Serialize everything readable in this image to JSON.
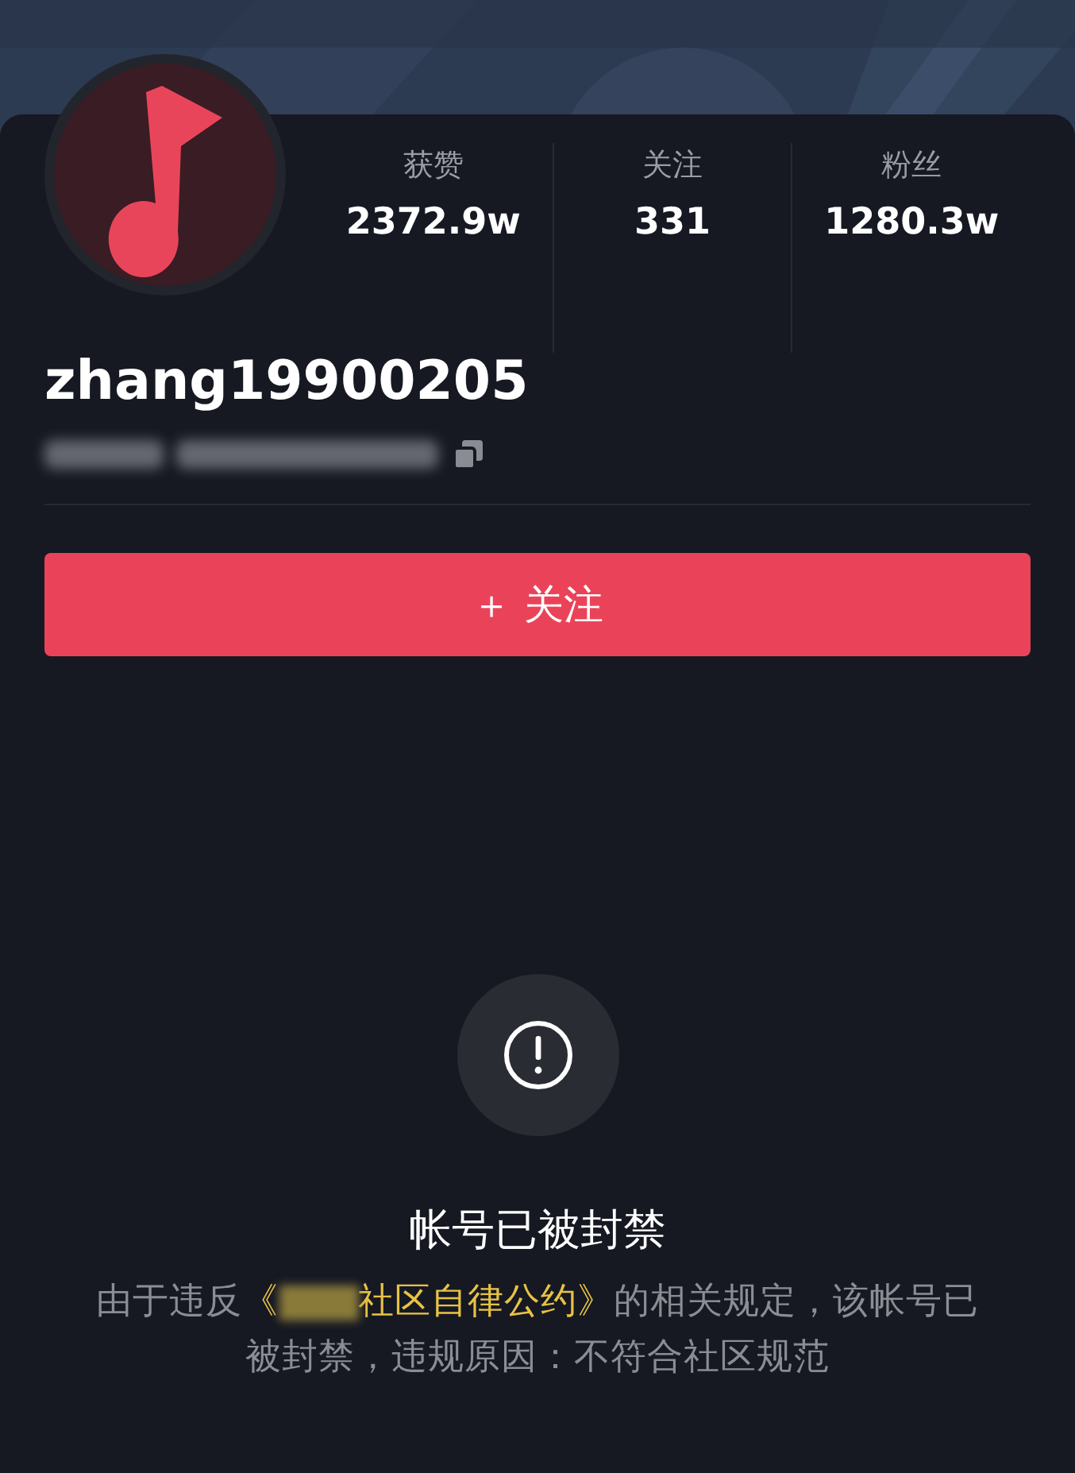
{
  "stats": [
    {
      "label": "获赞",
      "value": "2372.9w"
    },
    {
      "label": "关注",
      "value": "331"
    },
    {
      "label": "粉丝",
      "value": "1280.3w"
    }
  ],
  "username": "zhang19900205",
  "follow_button": {
    "icon": "＋",
    "label": "关注"
  },
  "ban_notice": {
    "title": "帐号已被封禁",
    "prefix": "由于违反",
    "link_open": "《",
    "link_rest": "社区自律公约》",
    "suffix": "的相关规定，该帐号已被封禁，违规原因：不符合社区规范"
  }
}
